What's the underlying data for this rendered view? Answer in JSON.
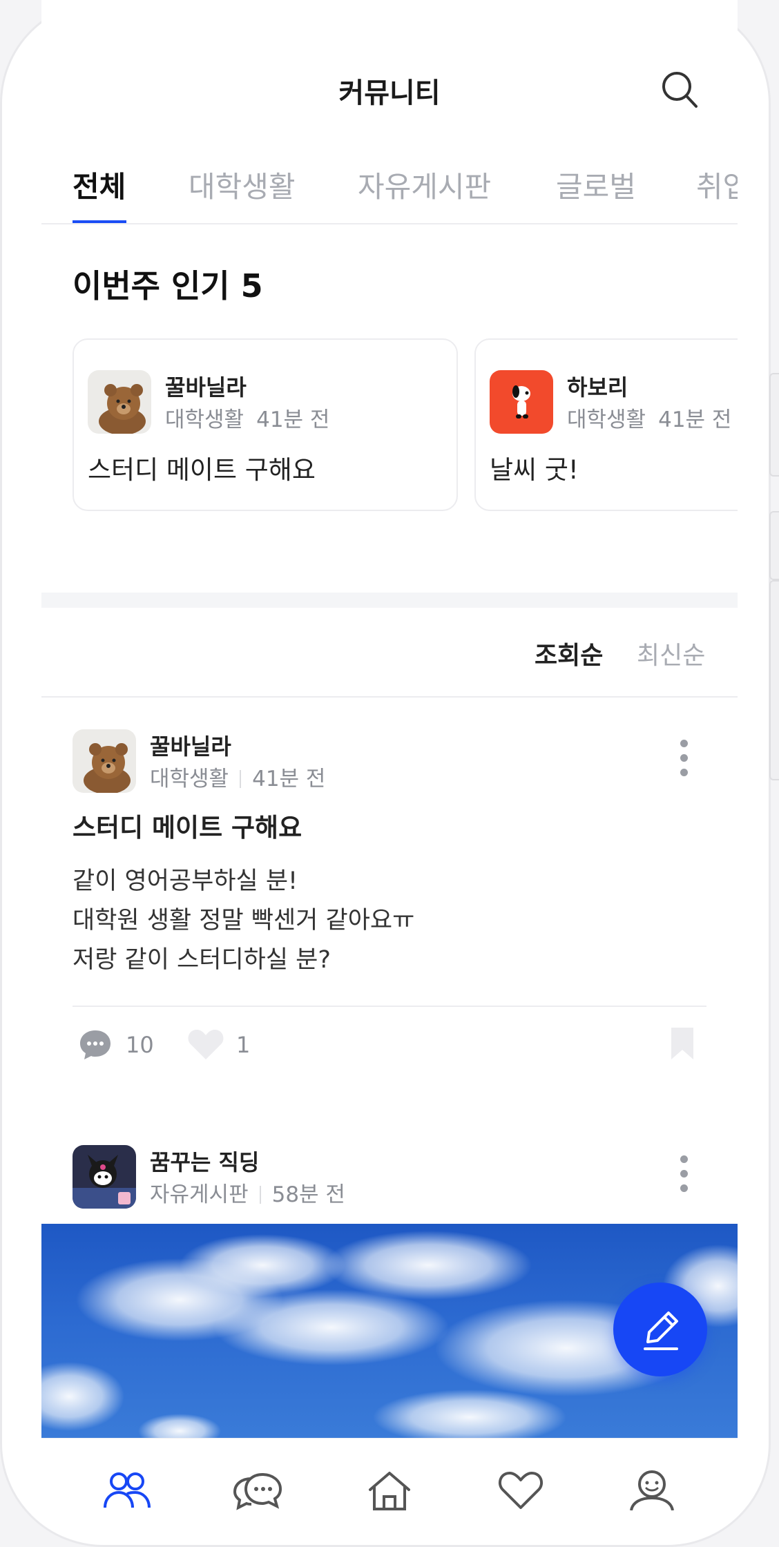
{
  "header": {
    "title": "커뮤니티",
    "search_icon": "search-icon"
  },
  "tabs": [
    {
      "label": "전체",
      "active": true
    },
    {
      "label": "대학생활",
      "active": false
    },
    {
      "label": "자유게시판",
      "active": false
    },
    {
      "label": "글로벌",
      "active": false
    },
    {
      "label": "취업",
      "active": false
    }
  ],
  "popular": {
    "title": "이번주 인기 5",
    "cards": [
      {
        "author": "꿀바닐라",
        "board": "대학생활",
        "time": "41분 전",
        "text": "스터디 메이트 구해요",
        "avatar": "bear-avatar"
      },
      {
        "author": "하보리",
        "board": "대학생활",
        "time": "41분 전",
        "text": "날씨 굿!",
        "avatar": "dog-avatar"
      }
    ]
  },
  "sort": {
    "options": [
      "조회순",
      "최신순"
    ],
    "active": "조회순"
  },
  "posts": [
    {
      "author": "꿀바닐라",
      "board": "대학생활",
      "time": "41분 전",
      "title": "스터디 메이트 구해요",
      "body": [
        "같이 영어공부하실 분!",
        "대학원 생활 정말 빡센거 같아요ㅠ",
        "저랑 같이 스터디하실 분?"
      ],
      "comments": "10",
      "likes": "1"
    },
    {
      "author": "꿈꾸는 직딩",
      "board": "자유게시판",
      "time": "58분 전",
      "image": "sky-clouds-photo"
    }
  ],
  "fab": {
    "icon": "pencil-icon"
  },
  "bottom_nav": [
    {
      "icon": "community-icon",
      "active": true
    },
    {
      "icon": "chat-icon",
      "active": false
    },
    {
      "icon": "home-icon",
      "active": false
    },
    {
      "icon": "heart-icon",
      "active": false
    },
    {
      "icon": "profile-icon",
      "active": false
    }
  ],
  "colors": {
    "accent": "#1747f5",
    "text": "#1a1a1a",
    "muted": "#8a8d94",
    "inactive_tab": "#a8abb2"
  }
}
